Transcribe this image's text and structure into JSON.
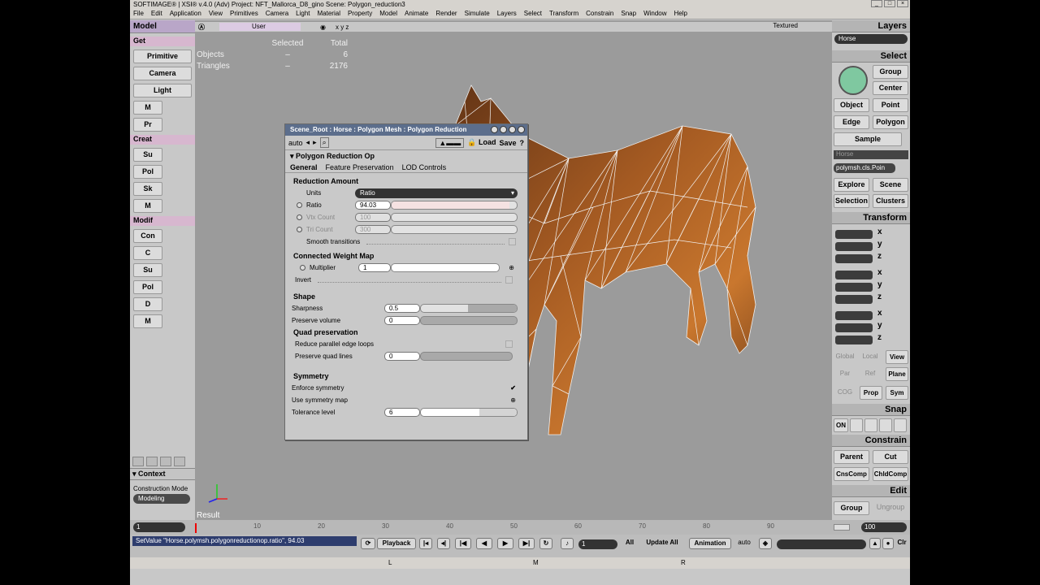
{
  "window": {
    "title": "SOFTIMAGE® | XSI® v.4.0 (Adv) Project: NFT_Mallorca_D8_gino    Scene: Polygon_reduction3"
  },
  "menu": [
    "File",
    "Edit",
    "Application",
    "View",
    "Primitives",
    "Camera",
    "Light",
    "Material",
    "Property",
    "Model",
    "Animate",
    "Render",
    "Simulate",
    "Layers",
    "Select",
    "Transform",
    "Constrain",
    "Snap",
    "Window",
    "Help"
  ],
  "left": {
    "title": "Model",
    "get": "Get",
    "buttons": [
      "Primitive",
      "Camera",
      "Light"
    ],
    "stubs": [
      "M",
      "Pr"
    ],
    "create": "Creat",
    "stubs2": [
      "Su",
      "Pol",
      "Sk",
      "M"
    ],
    "modify": "Modif",
    "stubs3": [
      "Con",
      "C",
      "Su",
      "Pol",
      "D",
      "M"
    ],
    "context": "Context",
    "construction_mode_label": "Construction Mode",
    "construction_mode": "Modeling"
  },
  "viewport": {
    "camera": "User",
    "mode": "Textured",
    "stats": {
      "headers": [
        "Selected",
        "Total"
      ],
      "rows": [
        [
          "Objects",
          "–",
          "6"
        ],
        [
          "Triangles",
          "–",
          "2176"
        ]
      ]
    },
    "axis_caption": "Result"
  },
  "panel": {
    "title": "Scene_Root : Horse : Polygon Mesh : Polygon Reduction",
    "auto": "auto",
    "load": "Load",
    "save": "Save",
    "op": "Polygon Reduction Op",
    "tabs": [
      "General",
      "Feature Preservation",
      "LOD Controls"
    ],
    "reduction_amount": "Reduction Amount",
    "units_label": "Units",
    "units_value": "Ratio",
    "ratio_label": "Ratio",
    "ratio_value": "94.03",
    "ratio_fraction": 0.94,
    "vtx_label": "Vtx Count",
    "vtx_value": "100",
    "tri_label": "Tri Count",
    "tri_value": "300",
    "smooth_label": "Smooth transitions",
    "weight_map": "Connected Weight Map",
    "multiplier_label": "Multiplier",
    "multiplier_value": "1",
    "invert_label": "Invert",
    "shape": "Shape",
    "sharpness_label": "Sharpness",
    "sharpness_value": "0.5",
    "preserve_volume_label": "Preserve volume",
    "preserve_volume_value": "0",
    "quad": "Quad preservation",
    "reduce_parallel_label": "Reduce parallel edge loops",
    "preserve_quad_label": "Preserve quad lines",
    "preserve_quad_value": "0",
    "symmetry": "Symmetry",
    "enforce_label": "Enforce symmetry",
    "use_map_label": "Use symmetry map",
    "tolerance_label": "Tolerance level",
    "tolerance_value": "6"
  },
  "right": {
    "layers": "Layers",
    "layer_value": "Horse",
    "select": "Select",
    "group": "Group",
    "center": "Center",
    "object": "Object",
    "point": "Point",
    "edge": "Edge",
    "polygon": "Polygon",
    "sample": "Sample",
    "sel_name": "Horse",
    "cluster_field": "polymsh.cls.Poin",
    "explore": "Explore",
    "scene": "Scene",
    "selection": "Selection",
    "clusters": "Clusters",
    "transform": "Transform",
    "axes": [
      "x",
      "y",
      "z"
    ],
    "global": "Global",
    "local": "Local",
    "view": "View",
    "par": "Par",
    "ref": "Ref",
    "plane": "Plane",
    "cog": "COG",
    "prop": "Prop",
    "sym": "Sym",
    "snap": "Snap",
    "on": "ON",
    "constrain": "Constrain",
    "parent": "Parent",
    "cut": "Cut",
    "cnscomp": "CnsComp",
    "chldcomp": "ChldComp",
    "edit": "Edit",
    "edit_group": "Group",
    "ungroup": "Ungroup"
  },
  "timeline": {
    "start": "1",
    "end": "100",
    "ticks": [
      "10",
      "20",
      "30",
      "40",
      "50",
      "60",
      "70",
      "80",
      "90"
    ]
  },
  "command": {
    "line": "SetValue \"Horse.polymsh.polygonreductionop.ratio\", 94.03",
    "playback": "Playback",
    "frame": "1",
    "all": "All",
    "update_all": "Update All",
    "animation": "Animation",
    "auto": "auto"
  },
  "status": {
    "l": "L",
    "m": "M",
    "r": "R"
  }
}
